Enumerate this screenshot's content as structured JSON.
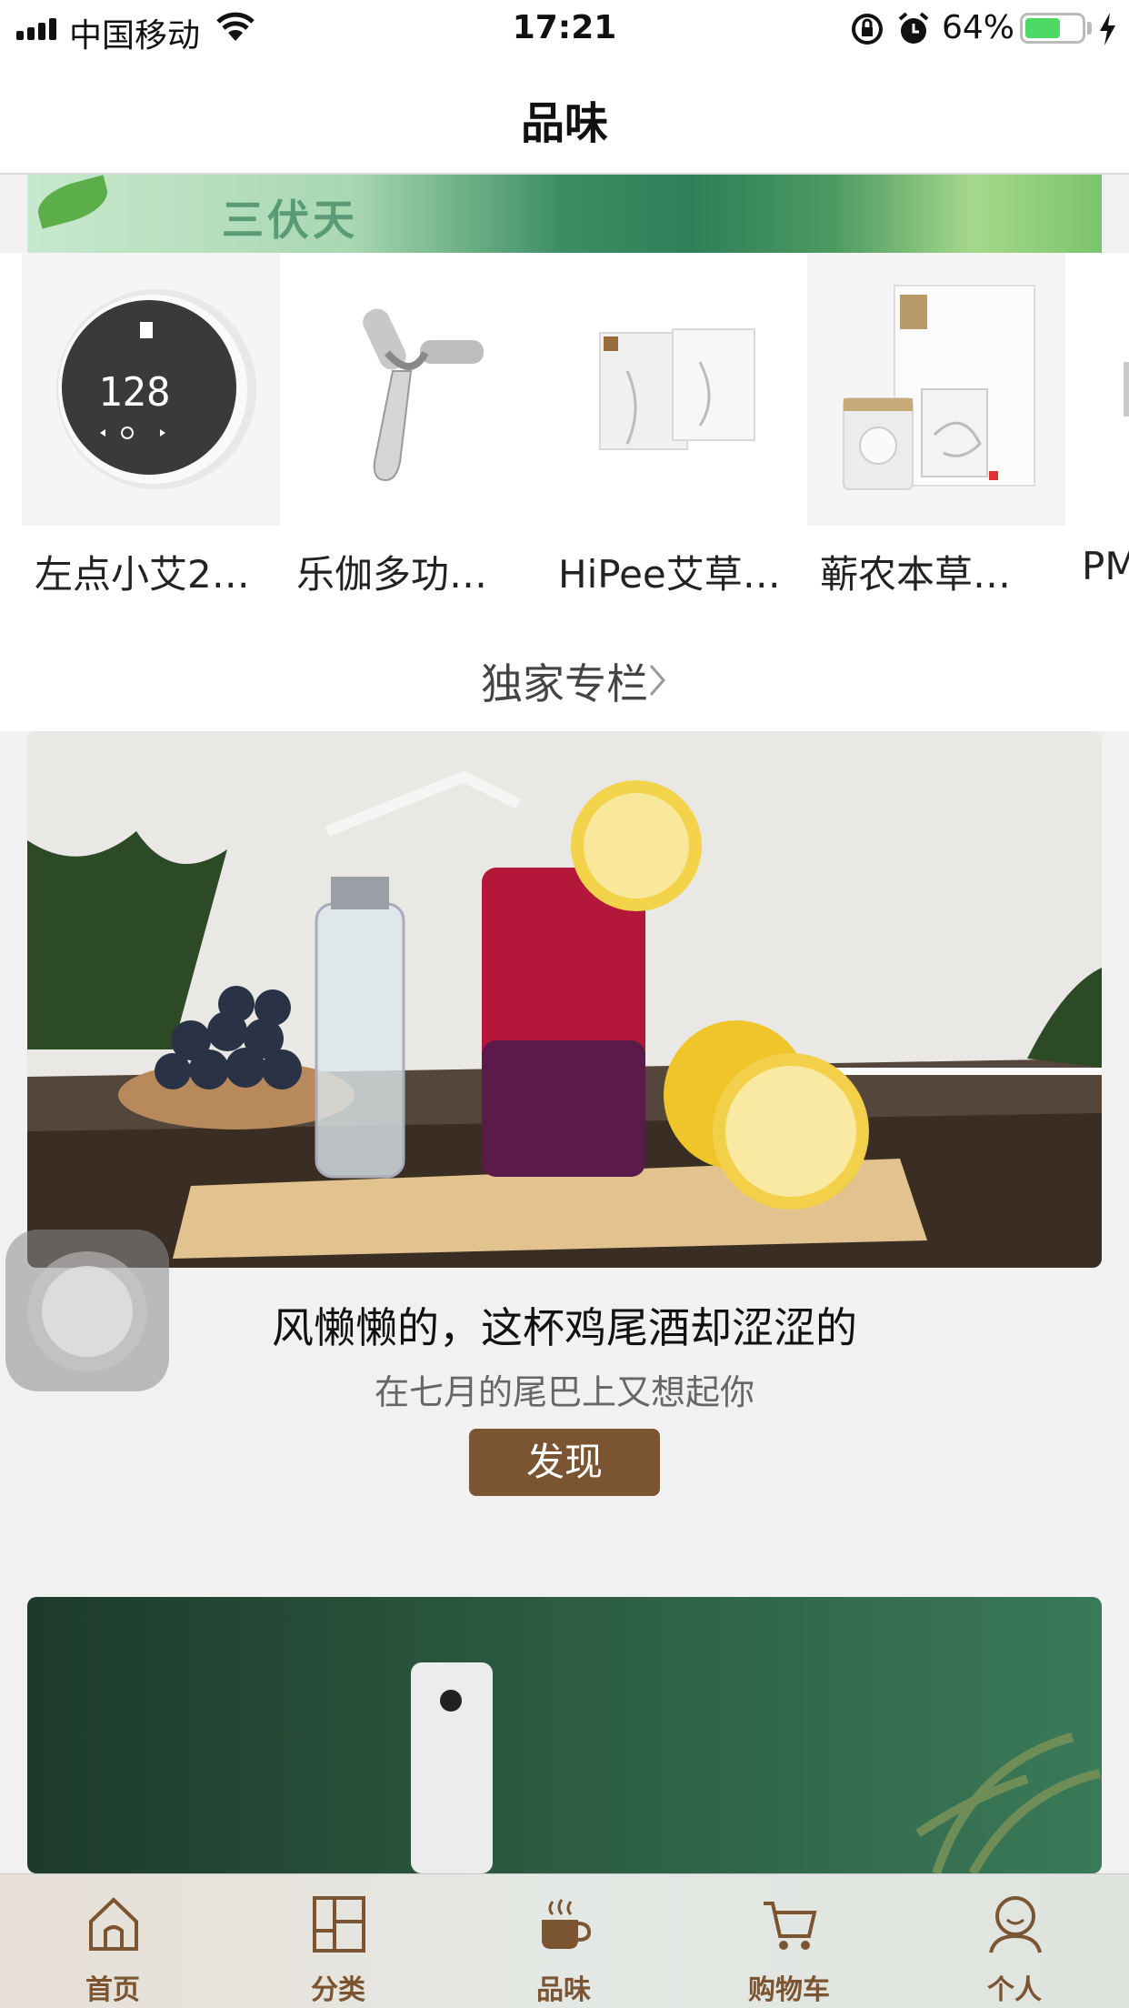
{
  "status_bar": {
    "carrier": "中国移动",
    "time": "17:21",
    "battery_percent": "64%",
    "battery_level": 0.64
  },
  "nav": {
    "title": "品味"
  },
  "banner": {
    "text": "三伏天"
  },
  "products": [
    {
      "name": "左点小艾2…",
      "image_icon": "moxibustion-device-image"
    },
    {
      "name": "乐伽多功…",
      "image_icon": "massage-roller-image"
    },
    {
      "name": "HiPee艾草…",
      "image_icon": "moxa-patch-image"
    },
    {
      "name": "蕲农本草…",
      "image_icon": "acupressure-patch-image"
    },
    {
      "name": "PM…",
      "image_icon": "partial-product-image"
    }
  ],
  "section": {
    "label": "独家专栏"
  },
  "articles": [
    {
      "title": "风懒懒的，这杯鸡尾酒却涩涩的",
      "subtitle": "在七月的尾巴上又想起你",
      "button": "发现",
      "image_icon": "cocktail-photo"
    },
    {
      "image_icon": "air-purifier-photo"
    }
  ],
  "tabs": [
    {
      "label": "首页",
      "icon": "home-icon"
    },
    {
      "label": "分类",
      "icon": "category-icon"
    },
    {
      "label": "品味",
      "icon": "coffee-cup-icon"
    },
    {
      "label": "购物车",
      "icon": "cart-icon"
    },
    {
      "label": "个人",
      "icon": "person-icon"
    }
  ],
  "colors": {
    "accent": "#7b5431",
    "battery": "#4cd964",
    "background": "#f1f1f1"
  }
}
